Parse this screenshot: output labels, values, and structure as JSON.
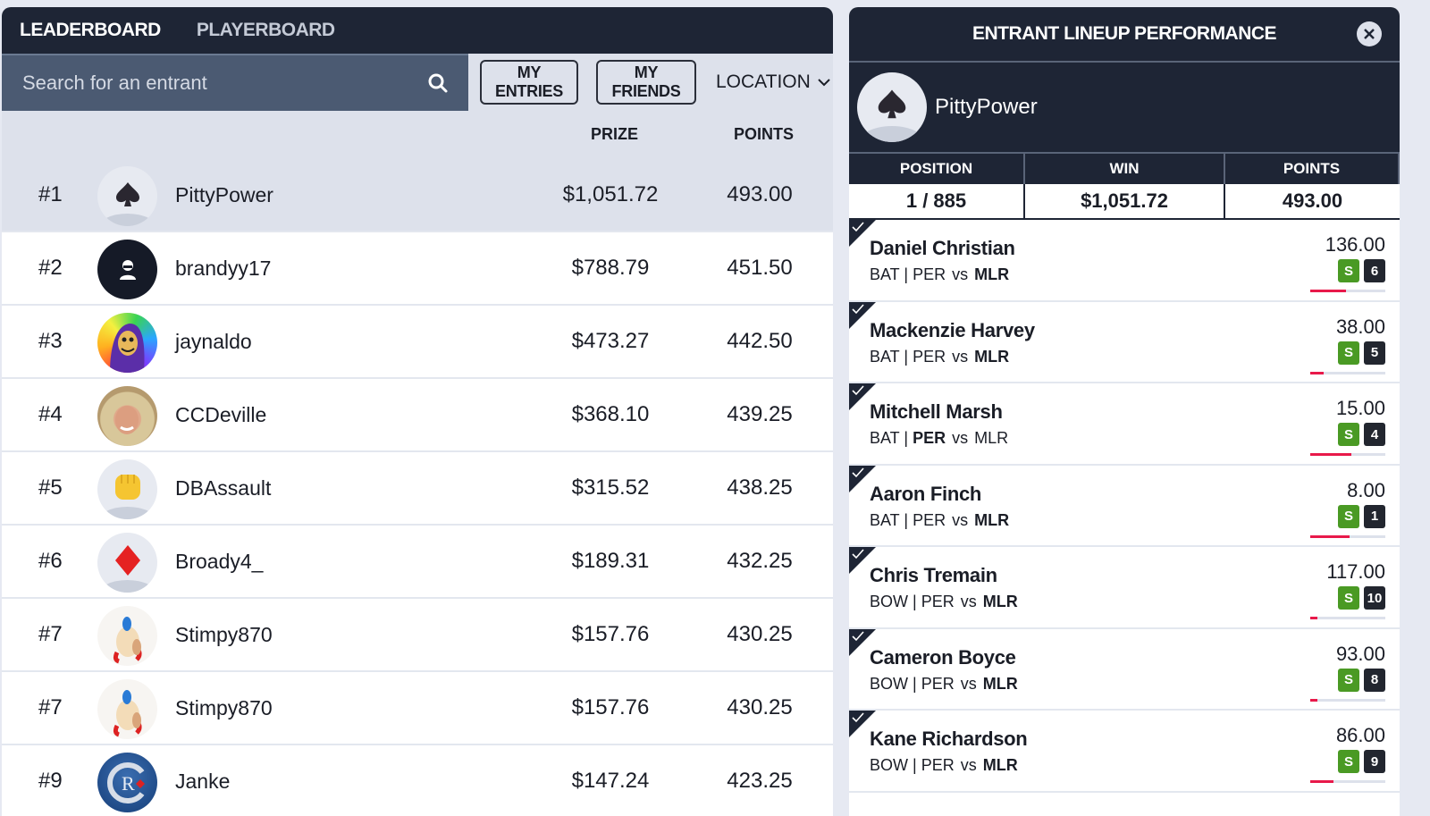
{
  "leaderboard": {
    "tabs": [
      {
        "label": "LEADERBOARD",
        "active": true
      },
      {
        "label": "PLAYERBOARD",
        "active": false
      }
    ],
    "search": {
      "placeholder": "Search for an entrant",
      "value": "",
      "icon": "search-icon"
    },
    "buttons": {
      "my_entries": "MY ENTRIES",
      "my_friends": "MY FRIENDS",
      "location": "LOCATION"
    },
    "columns": {
      "prize": "PRIZE",
      "points": "POINTS"
    },
    "rows": [
      {
        "rank": "#1",
        "name": "PittyPower",
        "prize": "$1,051.72",
        "points": "493.00",
        "avatar": "spade",
        "highlighted": true
      },
      {
        "rank": "#2",
        "name": "brandyy17",
        "prize": "$788.79",
        "points": "451.50",
        "avatar": "default-user"
      },
      {
        "rank": "#3",
        "name": "jaynaldo",
        "prize": "$473.27",
        "points": "442.50",
        "avatar": "rainbow-skeletor"
      },
      {
        "rank": "#4",
        "name": "CCDeville",
        "prize": "$368.10",
        "points": "439.25",
        "avatar": "photo"
      },
      {
        "rank": "#5",
        "name": "DBAssault",
        "prize": "$315.52",
        "points": "438.25",
        "avatar": "fist"
      },
      {
        "rank": "#6",
        "name": "Broady4_",
        "prize": "$189.31",
        "points": "432.25",
        "avatar": "diamond"
      },
      {
        "rank": "#7",
        "name": "Stimpy870",
        "prize": "$157.76",
        "points": "430.25",
        "avatar": "cartoon"
      },
      {
        "rank": "#7",
        "name": "Stimpy870",
        "prize": "$157.76",
        "points": "430.25",
        "avatar": "cartoon"
      },
      {
        "rank": "#9",
        "name": "Janke",
        "prize": "$147.24",
        "points": "423.25",
        "avatar": "logo-r"
      }
    ]
  },
  "panel": {
    "title": "ENTRANT LINEUP PERFORMANCE",
    "user": {
      "name": "PittyPower",
      "avatar": "spade"
    },
    "stats": {
      "headers": [
        "POSITION",
        "WIN",
        "POINTS"
      ],
      "values": [
        "1 / 885",
        "$1,051.72",
        "493.00"
      ]
    },
    "players": [
      {
        "name": "Daniel Christian",
        "role": "BAT",
        "team": "PER",
        "vs": "vs",
        "opp": "MLR",
        "bold": "opp",
        "score": "136.00",
        "badge_s": "S",
        "badge_n": "6",
        "progress": 0.48
      },
      {
        "name": "Mackenzie Harvey",
        "role": "BAT",
        "team": "PER",
        "vs": "vs",
        "opp": "MLR",
        "bold": "opp",
        "score": "38.00",
        "badge_s": "S",
        "badge_n": "5",
        "progress": 0.18
      },
      {
        "name": "Mitchell Marsh",
        "role": "BAT",
        "team": "PER",
        "vs": "vs",
        "opp": "MLR",
        "bold": "team",
        "score": "15.00",
        "badge_s": "S",
        "badge_n": "4",
        "progress": 0.55
      },
      {
        "name": "Aaron Finch",
        "role": "BAT",
        "team": "PER",
        "vs": "vs",
        "opp": "MLR",
        "bold": "opp",
        "score": "8.00",
        "badge_s": "S",
        "badge_n": "1",
        "progress": 0.52
      },
      {
        "name": "Chris Tremain",
        "role": "BOW",
        "team": "PER",
        "vs": "vs",
        "opp": "MLR",
        "bold": "opp",
        "score": "117.00",
        "badge_s": "S",
        "badge_n": "10",
        "progress": 0.1
      },
      {
        "name": "Cameron Boyce",
        "role": "BOW",
        "team": "PER",
        "vs": "vs",
        "opp": "MLR",
        "bold": "opp",
        "score": "93.00",
        "badge_s": "S",
        "badge_n": "8",
        "progress": 0.1
      },
      {
        "name": "Kane Richardson",
        "role": "BOW",
        "team": "PER",
        "vs": "vs",
        "opp": "MLR",
        "bold": "opp",
        "score": "86.00",
        "badge_s": "S",
        "badge_n": "9",
        "progress": 0.31
      }
    ]
  },
  "colors": {
    "header_bg": "#1e2535",
    "search_bg": "#4b5a72",
    "highlight_row": "#dde1eb",
    "badge_green": "#4a9a24",
    "badge_dark": "#22262f",
    "progress_red": "#e8194a"
  }
}
